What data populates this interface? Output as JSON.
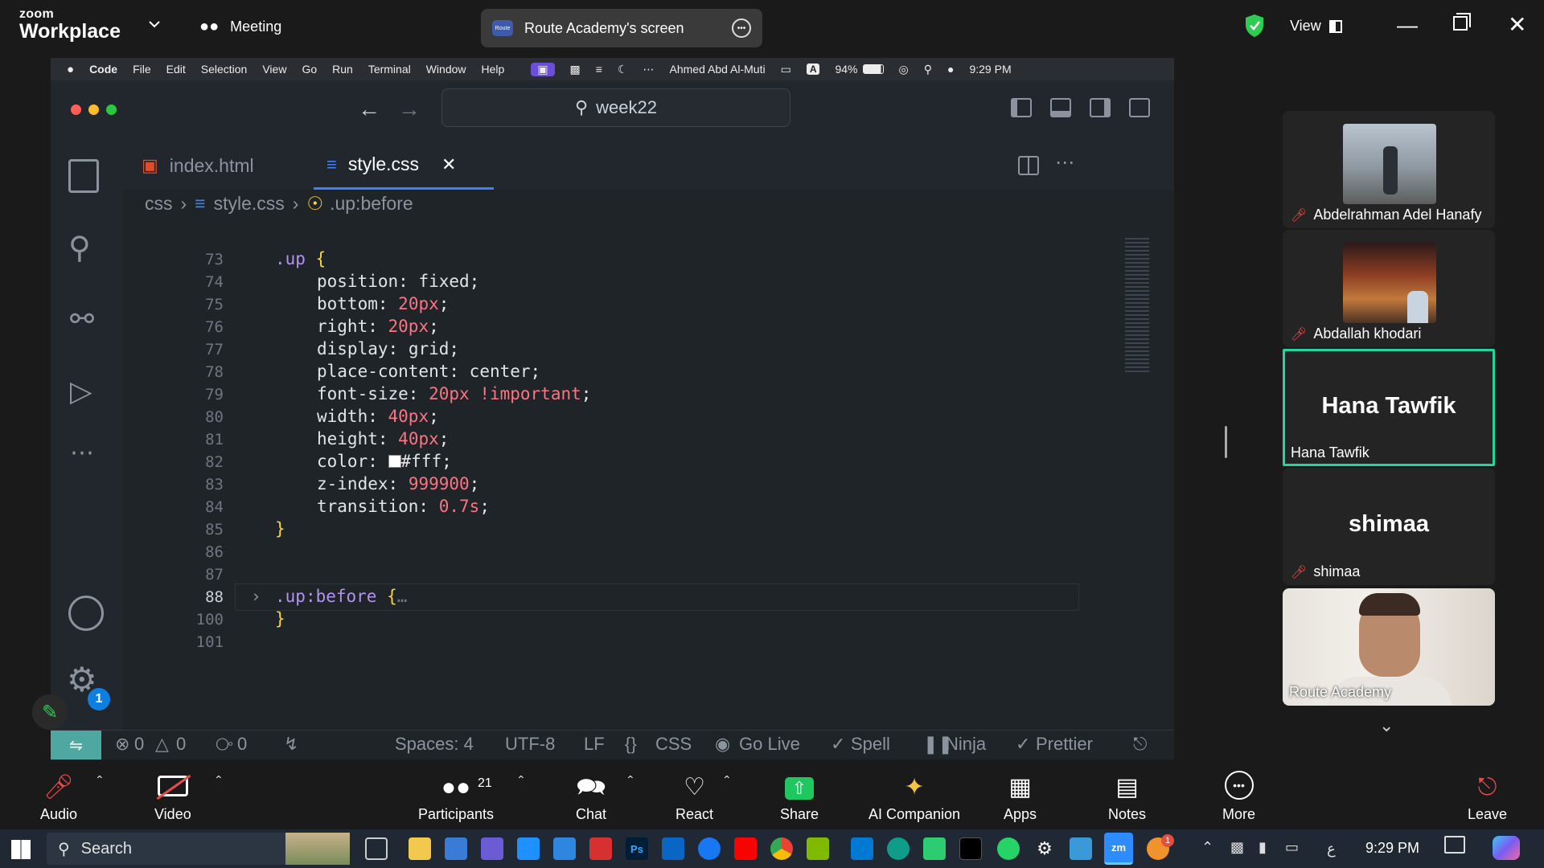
{
  "zoom": {
    "logo_top": "zoom",
    "logo_bottom": "Workplace",
    "meeting_label": "Meeting",
    "screen_share_label": "Route Academy's screen",
    "screen_badge": "Route",
    "view_label": "View"
  },
  "mac_menu": {
    "app": "Code",
    "items": [
      "File",
      "Edit",
      "Selection",
      "View",
      "Go",
      "Run",
      "Terminal",
      "Window",
      "Help"
    ],
    "user": "Ahmed Abd Al-Muti",
    "battery": "94%",
    "time": "9:29 PM",
    "input_badge": "A"
  },
  "vscode": {
    "search_text": "week22",
    "tabs": [
      {
        "label": "index.html",
        "active": false
      },
      {
        "label": "style.css",
        "active": true
      }
    ],
    "breadcrumb": [
      "css",
      "style.css",
      ".up:before"
    ],
    "line_numbers": [
      "73",
      "74",
      "75",
      "76",
      "77",
      "78",
      "79",
      "80",
      "81",
      "82",
      "83",
      "84",
      "85",
      "86",
      "87",
      "88",
      "100",
      "101"
    ],
    "code": {
      "l73_sel": ".up",
      "l73_brace": "{",
      "l74_prop": "position:",
      "l74_val": "fixed",
      "l74_end": ";",
      "l75_prop": "bottom:",
      "l75_val": "20px",
      "l75_end": ";",
      "l76_prop": "right:",
      "l76_val": "20px",
      "l76_end": ";",
      "l77_prop": "display:",
      "l77_val": "grid",
      "l77_end": ";",
      "l78_prop": "place-content:",
      "l78_val": "center",
      "l78_end": ";",
      "l79_prop": "font-size:",
      "l79_val": "20px",
      "l79_imp": "!important",
      "l79_end": ";",
      "l80_prop": "width:",
      "l80_val": "40px",
      "l80_end": ";",
      "l81_prop": "height:",
      "l81_val": "40px",
      "l81_end": ";",
      "l82_prop": "color:",
      "l82_val": "#fff",
      "l82_end": ";",
      "l83_prop": "z-index:",
      "l83_val": "999900",
      "l83_end": ";",
      "l84_prop": "transition:",
      "l84_val": "0.7s",
      "l84_end": ";",
      "l85_brace": "}",
      "l88_sel": ".up",
      "l88_pseudo": ":before",
      "l88_brace": "{",
      "l88_fold": "…",
      "l100_brace": "}"
    },
    "status": {
      "errors": "0",
      "warnings": "0",
      "ports": "0",
      "spaces": "Spaces: 4",
      "encoding": "UTF-8",
      "eol": "LF",
      "language": "CSS",
      "go_live": "Go Live",
      "spell": "Spell",
      "ninja": "Ninja",
      "prettier": "Prettier",
      "settings_badge": "1"
    }
  },
  "participants": [
    {
      "name": "Abdelrahman Adel Hanafy",
      "muted": true,
      "video": "photo"
    },
    {
      "name": "Abdallah khodari",
      "muted": true,
      "video": "photo"
    },
    {
      "name": "Hana Tawfik",
      "muted": false,
      "big_name": "Hana Tawfik",
      "active_speaker": true
    },
    {
      "name": "shimaa",
      "muted": true,
      "big_name": "shimaa"
    },
    {
      "name": "Route Academy",
      "muted": false,
      "video": "camera"
    }
  ],
  "toolbar": {
    "audio": "Audio",
    "video": "Video",
    "participants": "Participants",
    "participants_count": "21",
    "chat": "Chat",
    "react": "React",
    "share": "Share",
    "ai": "AI Companion",
    "apps": "Apps",
    "notes": "Notes",
    "more": "More",
    "leave": "Leave"
  },
  "taskbar": {
    "search": "Search",
    "time": "9:29 PM",
    "lang": "ع",
    "notif_badge": "1",
    "zm": "zm",
    "ps": "Ps"
  },
  "colors": {
    "accent_green": "#23d5a0",
    "share_green": "#1ec760",
    "mute_red": "#e94b4b"
  }
}
